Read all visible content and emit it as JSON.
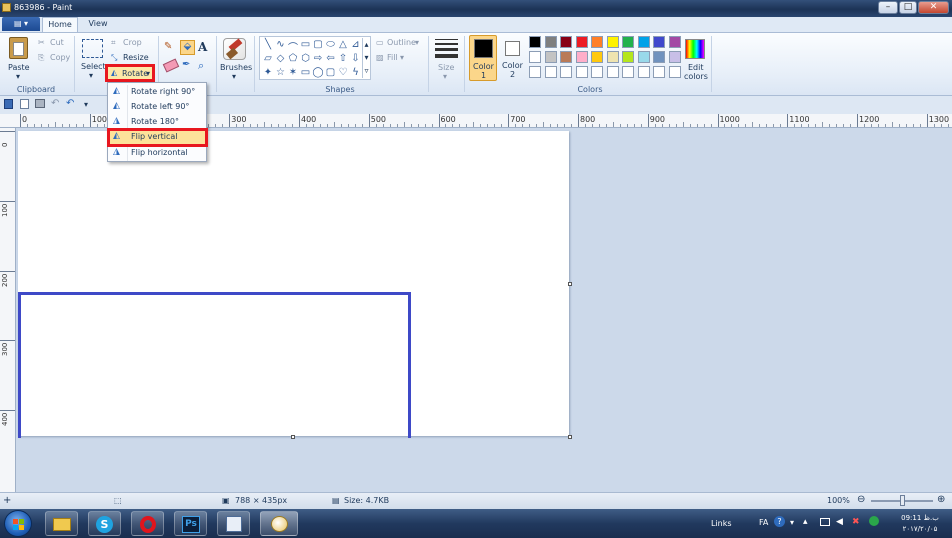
{
  "window": {
    "title": "863986 - Paint",
    "minimize": "–",
    "maximize": "□",
    "close": "✕"
  },
  "tabs": {
    "file_icon": "file-menu-icon",
    "home": "Home",
    "view": "View"
  },
  "clipboard": {
    "paste": "Paste",
    "cut": "Cut",
    "copy": "Copy",
    "group": "Clipboard"
  },
  "image": {
    "select": "Select",
    "crop": "Crop",
    "resize": "Resize",
    "rotate": "Rotate",
    "group": ""
  },
  "tools": {
    "brushes": "Brushes"
  },
  "shapes": {
    "outline": "Outline",
    "fill": "Fill",
    "group": "Shapes"
  },
  "size": {
    "label": "Size"
  },
  "colors": {
    "color1": "Color\n1",
    "color1_a": "Color",
    "color1_b": "1",
    "color2_a": "Color",
    "color2_b": "2",
    "edit_a": "Edit",
    "edit_b": "colors",
    "group": "Colors",
    "palette": [
      "#000000",
      "#7f7f7f",
      "#880015",
      "#ed1c24",
      "#ff7f27",
      "#fff200",
      "#22b14c",
      "#00a2e8",
      "#3f48cc",
      "#a349a4",
      "#ffffff",
      "#c3c3c3",
      "#b97a57",
      "#ffaec9",
      "#ffc90e",
      "#efe4b0",
      "#b5e61d",
      "#99d9ea",
      "#7092be",
      "#c8bfe7"
    ]
  },
  "ruler": {
    "h_ticks": [
      "0",
      "100",
      "200",
      "300",
      "400",
      "500",
      "600",
      "700",
      "800",
      "900",
      "1000",
      "1100",
      "1200",
      "1300"
    ],
    "v_ticks": [
      "0",
      "100",
      "200",
      "300",
      "400"
    ]
  },
  "rotate_menu": {
    "items": [
      {
        "label": "Rotate right 90°",
        "icon": "rotate-right-icon"
      },
      {
        "label": "Rotate left 90°",
        "icon": "rotate-left-icon"
      },
      {
        "label": "Rotate 180°",
        "icon": "rotate-180-icon"
      },
      {
        "label": "Flip vertical",
        "icon": "flip-vertical-icon"
      },
      {
        "label": "Flip horizontal",
        "icon": "flip-horizontal-icon"
      }
    ]
  },
  "status": {
    "dimensions": "788 × 435px",
    "size": "Size: 4.7KB",
    "zoom": "100%",
    "zoom_level": 1.0
  },
  "taskbar": {
    "links": "Links",
    "lang": "FA",
    "time": "09:11 ب.ظ",
    "date": "۲۰۱۷/۲۰/۰۵"
  },
  "accent": {
    "highlight": "#e8171f",
    "selection_rect": "#3e49c7"
  }
}
